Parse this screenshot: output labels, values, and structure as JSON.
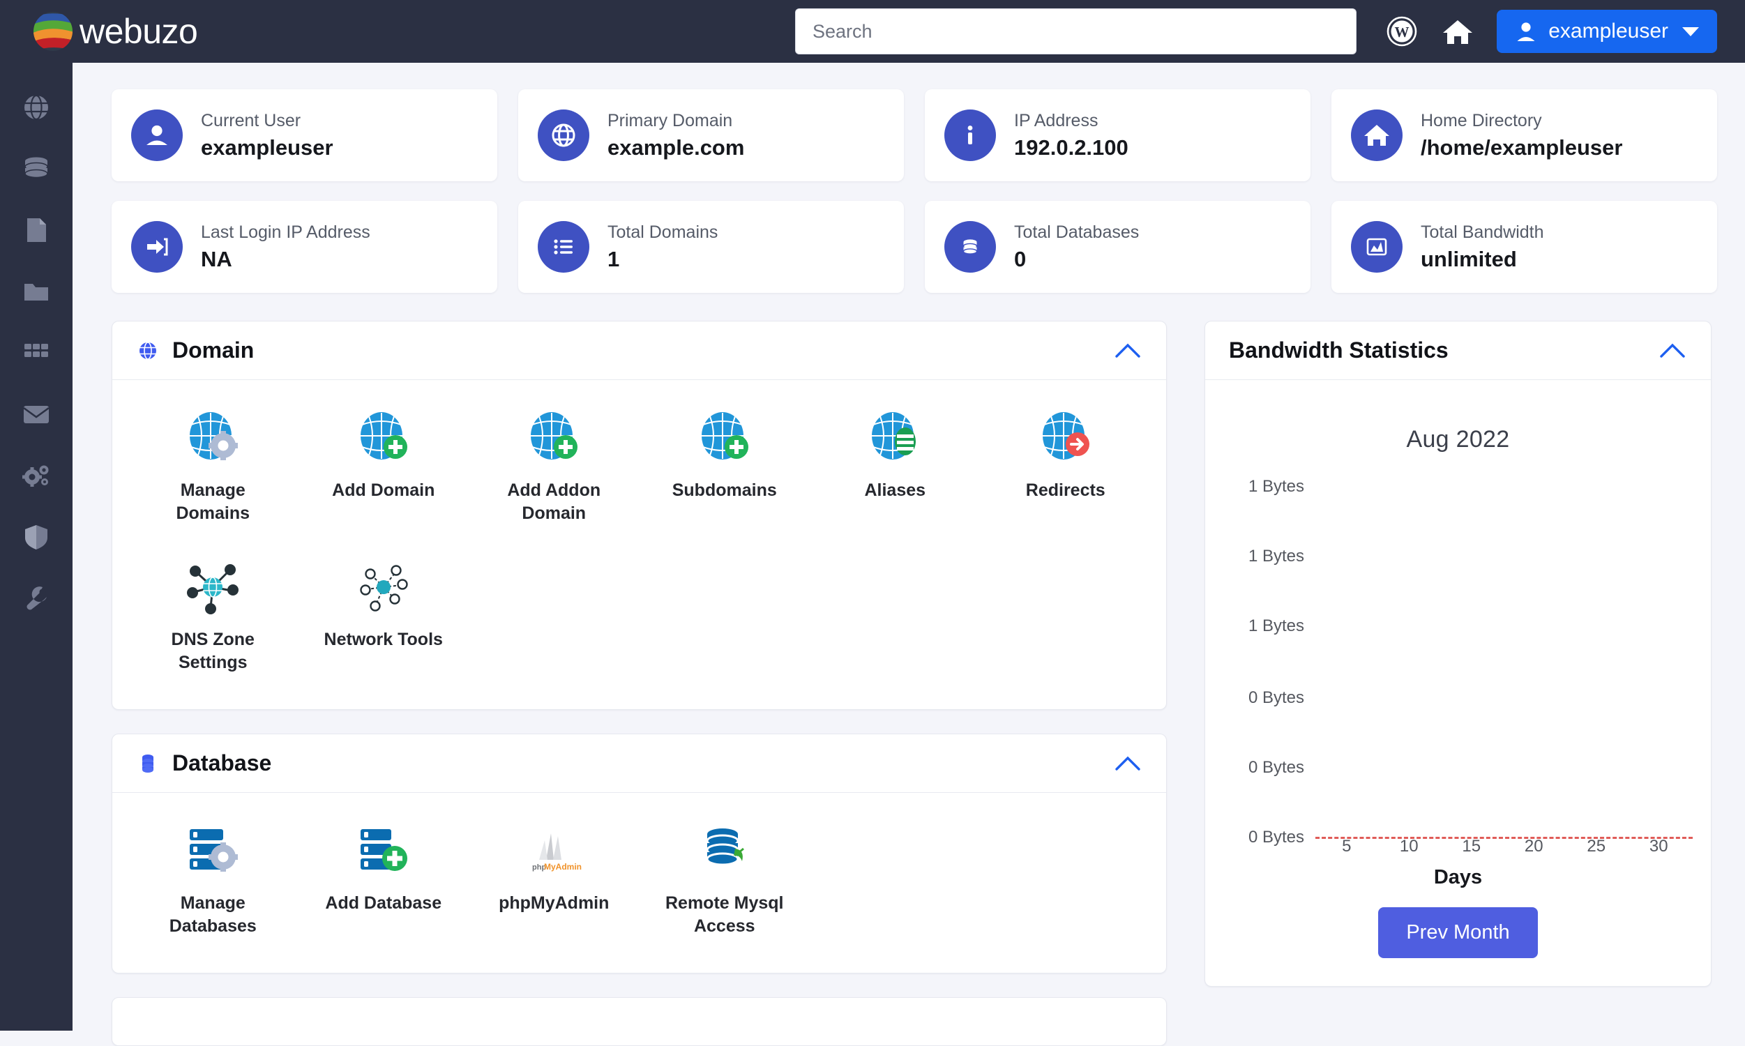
{
  "header": {
    "brand": "webuzo",
    "search": {
      "placeholder": "Search",
      "value": ""
    },
    "wordpress_icon": "wordpress-icon",
    "home_icon": "home-icon",
    "user_button": {
      "label": "exampleuser",
      "icon": "user-icon",
      "caret": "chevron-down-icon"
    }
  },
  "sidebar": {
    "items": [
      {
        "icon": "globe-icon",
        "name": "domain"
      },
      {
        "icon": "database-icon",
        "name": "database"
      },
      {
        "icon": "file-icon",
        "name": "files"
      },
      {
        "icon": "folder-icon",
        "name": "folders"
      },
      {
        "icon": "apps-grid-icon",
        "name": "apps"
      },
      {
        "icon": "envelope-icon",
        "name": "email"
      },
      {
        "icon": "gears-icon",
        "name": "settings"
      },
      {
        "icon": "shield-icon",
        "name": "security"
      },
      {
        "icon": "wrench-icon",
        "name": "tools"
      }
    ]
  },
  "stats": [
    {
      "label": "Current User",
      "value": "exampleuser",
      "icon": "user-icon"
    },
    {
      "label": "Primary Domain",
      "value": "example.com",
      "icon": "globe-icon"
    },
    {
      "label": "IP Address",
      "value": "192.0.2.100",
      "icon": "info-icon"
    },
    {
      "label": "Home Directory",
      "value": "/home/exampleuser",
      "icon": "home-icon"
    },
    {
      "label": "Last Login IP Address",
      "value": "NA",
      "icon": "login-arrow-icon"
    },
    {
      "label": "Total Domains",
      "value": "1",
      "icon": "list-icon"
    },
    {
      "label": "Total Databases",
      "value": "0",
      "icon": "database-icon"
    },
    {
      "label": "Total Bandwidth",
      "value": "unlimited",
      "icon": "chart-icon"
    }
  ],
  "domain_panel": {
    "title": "Domain",
    "icon": "globe-icon",
    "collapse_icon": "chevron-up-icon",
    "tiles": [
      {
        "label": "Manage Domains",
        "icon": "globe-gear-icon"
      },
      {
        "label": "Add Domain",
        "icon": "globe-plus-icon"
      },
      {
        "label": "Add Addon Domain",
        "icon": "globe-plus-icon"
      },
      {
        "label": "Subdomains",
        "icon": "globe-plus-icon"
      },
      {
        "label": "Aliases",
        "icon": "globe-list-icon"
      },
      {
        "label": "Redirects",
        "icon": "globe-arrow-icon"
      },
      {
        "label": "DNS Zone Settings",
        "icon": "dns-network-icon"
      },
      {
        "label": "Network Tools",
        "icon": "network-nodes-icon"
      }
    ]
  },
  "database_panel": {
    "title": "Database",
    "icon": "database-icon",
    "collapse_icon": "chevron-up-icon",
    "tiles": [
      {
        "label": "Manage Databases",
        "icon": "database-gear-icon"
      },
      {
        "label": "Add Database",
        "icon": "database-plus-icon"
      },
      {
        "label": "phpMyAdmin",
        "icon": "phpmyadmin-icon"
      },
      {
        "label": "Remote Mysql Access",
        "icon": "database-remote-icon"
      }
    ]
  },
  "bandwidth_panel": {
    "title": "Bandwidth Statistics",
    "collapse_icon": "chevron-up-icon",
    "prev_month_label": "Prev Month"
  },
  "chart_data": {
    "type": "line",
    "title": "Aug 2022",
    "xlabel": "Days",
    "ylabel": "",
    "x": [
      5,
      10,
      15,
      20,
      25,
      30
    ],
    "xtick_labels": [
      "5",
      "10",
      "15",
      "20",
      "25",
      "30"
    ],
    "ytick_labels": [
      "1 Bytes",
      "1 Bytes",
      "1 Bytes",
      "0 Bytes",
      "0 Bytes",
      "0 Bytes"
    ],
    "series": [
      {
        "name": "Bandwidth",
        "values": [
          0,
          0,
          0,
          0,
          0,
          0
        ],
        "color": "#e05c58",
        "style": "dashed"
      }
    ],
    "ylim": [
      0,
      1
    ],
    "grid": false,
    "legend": "none"
  },
  "colors": {
    "header_bg": "#2b3043",
    "sidebar_bg": "#2b3043",
    "page_bg": "#f4f5fa",
    "accent_blue": "#1667f0",
    "badge_indigo": "#3f51c2",
    "button_indigo": "#4f5ee0",
    "chart_line": "#e05c58"
  }
}
